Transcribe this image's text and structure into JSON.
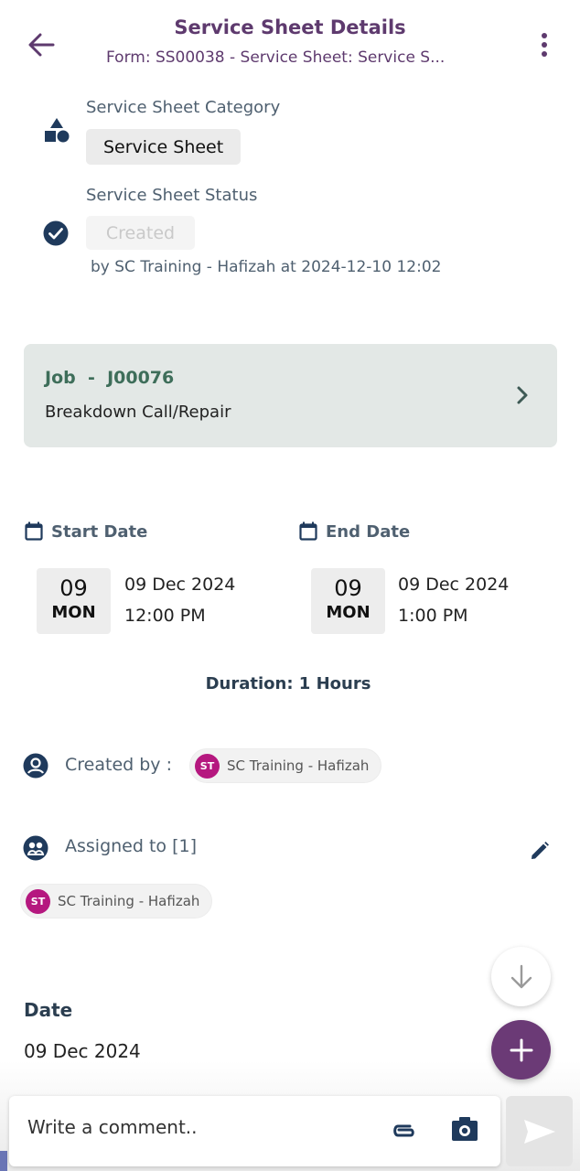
{
  "header": {
    "title": "Service Sheet Details",
    "subtitle": "Form: SS00038 - Service Sheet: Service S..."
  },
  "category": {
    "label": "Service Sheet Category",
    "value": "Service Sheet"
  },
  "status": {
    "label": "Service Sheet Status",
    "value": "Created",
    "by_line": "by SC Training - Hafizah at 2024-12-10 12:02"
  },
  "job": {
    "title": "Job  -  J00076",
    "description": "Breakdown Call/Repair"
  },
  "start": {
    "label": "Start Date",
    "day": "09",
    "weekday": "MON",
    "date": "09 Dec 2024",
    "time": "12:00 PM"
  },
  "end": {
    "label": "End Date",
    "day": "09",
    "weekday": "MON",
    "date": "09 Dec 2024",
    "time": "1:00 PM"
  },
  "duration": "Duration: 1 Hours",
  "created_by": {
    "label": "Created by :",
    "initials": "ST",
    "name": "SC Training - Hafizah"
  },
  "assigned": {
    "label": "Assigned to  [1]",
    "users": [
      {
        "initials": "ST",
        "name": "SC Training - Hafizah"
      }
    ]
  },
  "date_field": {
    "label": "Date",
    "value": "09 Dec 2024"
  },
  "comment": {
    "placeholder": "Write a comment.."
  },
  "colors": {
    "brand": "#6b3a76",
    "avatar": "#b5187f",
    "job_accent": "#3e6e5a",
    "icon": "#1f3a5c"
  }
}
